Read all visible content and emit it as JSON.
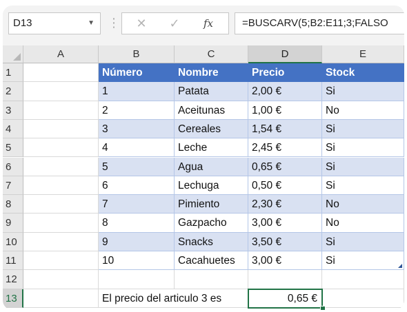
{
  "formula_bar": {
    "name_box": "D13",
    "cancel_glyph": "✕",
    "enter_glyph": "✓",
    "fx_label": "fx",
    "formula": "=BUSCARV(5;B2:E11;3;FALSO"
  },
  "columns": [
    "A",
    "B",
    "C",
    "D",
    "E"
  ],
  "rows": [
    "1",
    "2",
    "3",
    "4",
    "5",
    "6",
    "7",
    "8",
    "9",
    "10",
    "11",
    "12",
    "13"
  ],
  "table": {
    "headers": [
      "Número",
      "Nombre",
      "Precio",
      "Stock"
    ],
    "rows": [
      [
        "1",
        "Patata",
        "2,00 €",
        "Si"
      ],
      [
        "2",
        "Aceitunas",
        "1,00 €",
        "No"
      ],
      [
        "3",
        "Cereales",
        "1,54 €",
        "Si"
      ],
      [
        "4",
        "Leche",
        "2,45 €",
        "Si"
      ],
      [
        "5",
        "Agua",
        "0,65 €",
        "Si"
      ],
      [
        "6",
        "Lechuga",
        "0,50 €",
        "Si"
      ],
      [
        "7",
        "Pimiento",
        "2,30 €",
        "No"
      ],
      [
        "8",
        "Gazpacho",
        "3,00 €",
        "No"
      ],
      [
        "9",
        "Snacks",
        "3,50 €",
        "Si"
      ],
      [
        "10",
        "Cacahuetes",
        "3,00 €",
        "Si"
      ]
    ]
  },
  "result": {
    "label": "El precio del articulo 3 es",
    "value": "0,65 €"
  },
  "colors": {
    "header_fill": "#4472c4",
    "band_fill": "#d9e1f2",
    "selection": "#217346"
  }
}
